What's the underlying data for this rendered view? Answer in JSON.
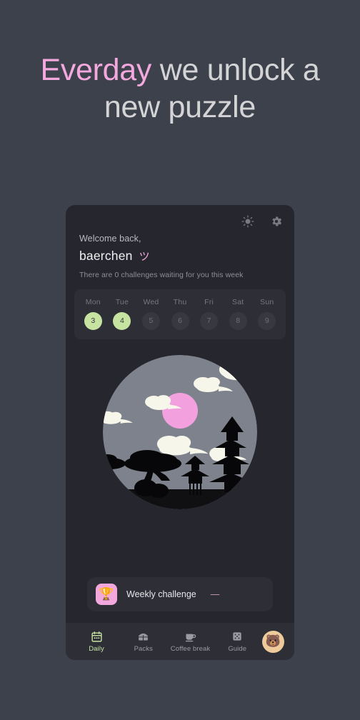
{
  "headline": {
    "accent_word": "Everday",
    "rest": " we unlock a new puzzle",
    "accent_color": "#f3a8de"
  },
  "card": {
    "top_icons": [
      {
        "name": "brightness-icon",
        "label": "Brightness"
      },
      {
        "name": "settings-icon",
        "label": "Settings"
      }
    ],
    "greeting": {
      "welcome": "Welcome back,",
      "username": "baerchen",
      "kaomoji": "ツ",
      "subtitle": "There are 0 challenges waiting for you this week"
    },
    "week": {
      "days": [
        {
          "label": "Mon",
          "date": "3",
          "active": true
        },
        {
          "label": "Tue",
          "date": "4",
          "active": true
        },
        {
          "label": "Wed",
          "date": "5",
          "active": false
        },
        {
          "label": "Thu",
          "date": "6",
          "active": false
        },
        {
          "label": "Fri",
          "date": "7",
          "active": false
        },
        {
          "label": "Sat",
          "date": "8",
          "active": false
        },
        {
          "label": "Sun",
          "date": "9",
          "active": false
        }
      ],
      "active_color": "#c7e3a2"
    },
    "illustration": {
      "name": "japanese-night-scene",
      "moon_color": "#f3a0de",
      "sky_color": "#7e828c",
      "cloud_color": "#f7f6ea",
      "silhouette_color": "#070709"
    },
    "challenge": {
      "icon": "trophy-icon",
      "icon_glyph": "🏆",
      "label": "Weekly challenge",
      "value": "—",
      "tile_color": "#f2a7dd"
    },
    "nav": {
      "items": [
        {
          "icon": "calendar-icon",
          "label": "Daily",
          "active": true
        },
        {
          "icon": "packs-icon",
          "label": "Packs",
          "active": false
        },
        {
          "icon": "coffee-cup-icon",
          "label": "Coffee break",
          "active": false
        },
        {
          "icon": "dice-icon",
          "label": "Guide",
          "active": false
        }
      ],
      "avatar": {
        "name": "bear-avatar",
        "glyph": "🐻"
      }
    }
  },
  "colors": {
    "page_background": "#3c414b",
    "card_background": "#26262e",
    "panel_background": "#2e2e37"
  }
}
